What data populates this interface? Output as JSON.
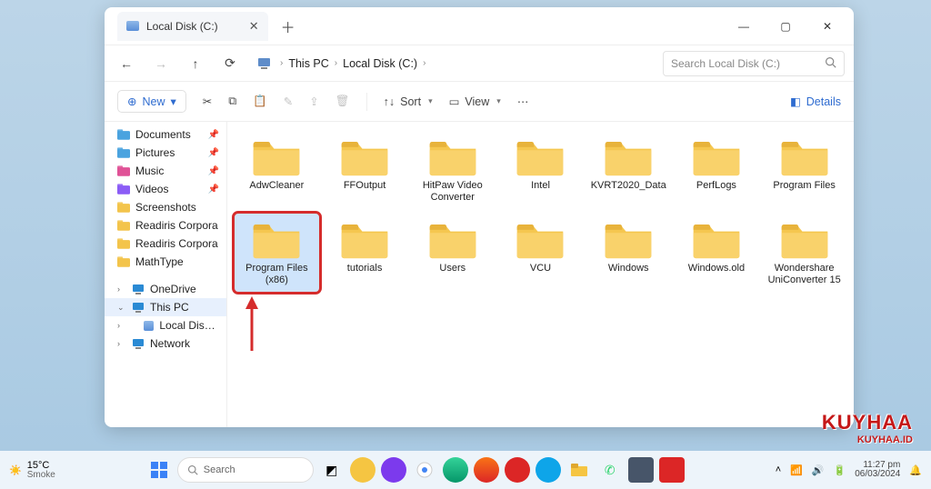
{
  "window": {
    "tab_title": "Local Disk (C:)",
    "search_placeholder": "Search Local Disk (C:)"
  },
  "breadcrumbs": [
    "This PC",
    "Local Disk (C:)"
  ],
  "toolbar": {
    "new": "New",
    "sort": "Sort",
    "view": "View",
    "details": "Details"
  },
  "nav": {
    "quick": [
      {
        "label": "Documents",
        "icon": "#4aa3df",
        "pinned": true
      },
      {
        "label": "Pictures",
        "icon": "#4aa3df",
        "pinned": true
      },
      {
        "label": "Music",
        "icon": "#e05297",
        "pinned": true
      },
      {
        "label": "Videos",
        "icon": "#8b5cf6",
        "pinned": true
      },
      {
        "label": "Screenshots",
        "icon": "#f3c44b",
        "pinned": false
      },
      {
        "label": "Readiris Corpora",
        "icon": "#f3c44b",
        "pinned": false
      },
      {
        "label": "Readiris Corpora",
        "icon": "#f3c44b",
        "pinned": false
      },
      {
        "label": "MathType",
        "icon": "#f3c44b",
        "pinned": false
      }
    ],
    "tree": [
      {
        "label": "OneDrive",
        "icon": "#2a8ad4",
        "expand": ">"
      },
      {
        "label": "This PC",
        "icon": "#2a8ad4",
        "expand": "v",
        "selected": true
      },
      {
        "label": "Local Disk (C:)",
        "icon": "disk",
        "expand": ">",
        "indent": true
      },
      {
        "label": "Network",
        "icon": "#2a8ad4",
        "expand": ">"
      }
    ]
  },
  "folders": [
    {
      "name": "AdwCleaner"
    },
    {
      "name": "FFOutput"
    },
    {
      "name": "HitPaw Video Converter"
    },
    {
      "name": "Intel"
    },
    {
      "name": "KVRT2020_Data"
    },
    {
      "name": "PerfLogs"
    },
    {
      "name": "Program Files"
    },
    {
      "name": "Program Files (x86)",
      "selected": true
    },
    {
      "name": "tutorials"
    },
    {
      "name": "Users"
    },
    {
      "name": "VCU"
    },
    {
      "name": "Windows"
    },
    {
      "name": "Windows.old"
    },
    {
      "name": "Wondershare UniConverter 15"
    }
  ],
  "taskbar": {
    "weather_temp": "15°C",
    "weather_cond": "Smoke",
    "search": "Search",
    "time": "11:27 pm",
    "date": "06/03/2024"
  },
  "watermark": {
    "l1": "KUYHAA",
    "l2": "KUYHAA.ID"
  }
}
